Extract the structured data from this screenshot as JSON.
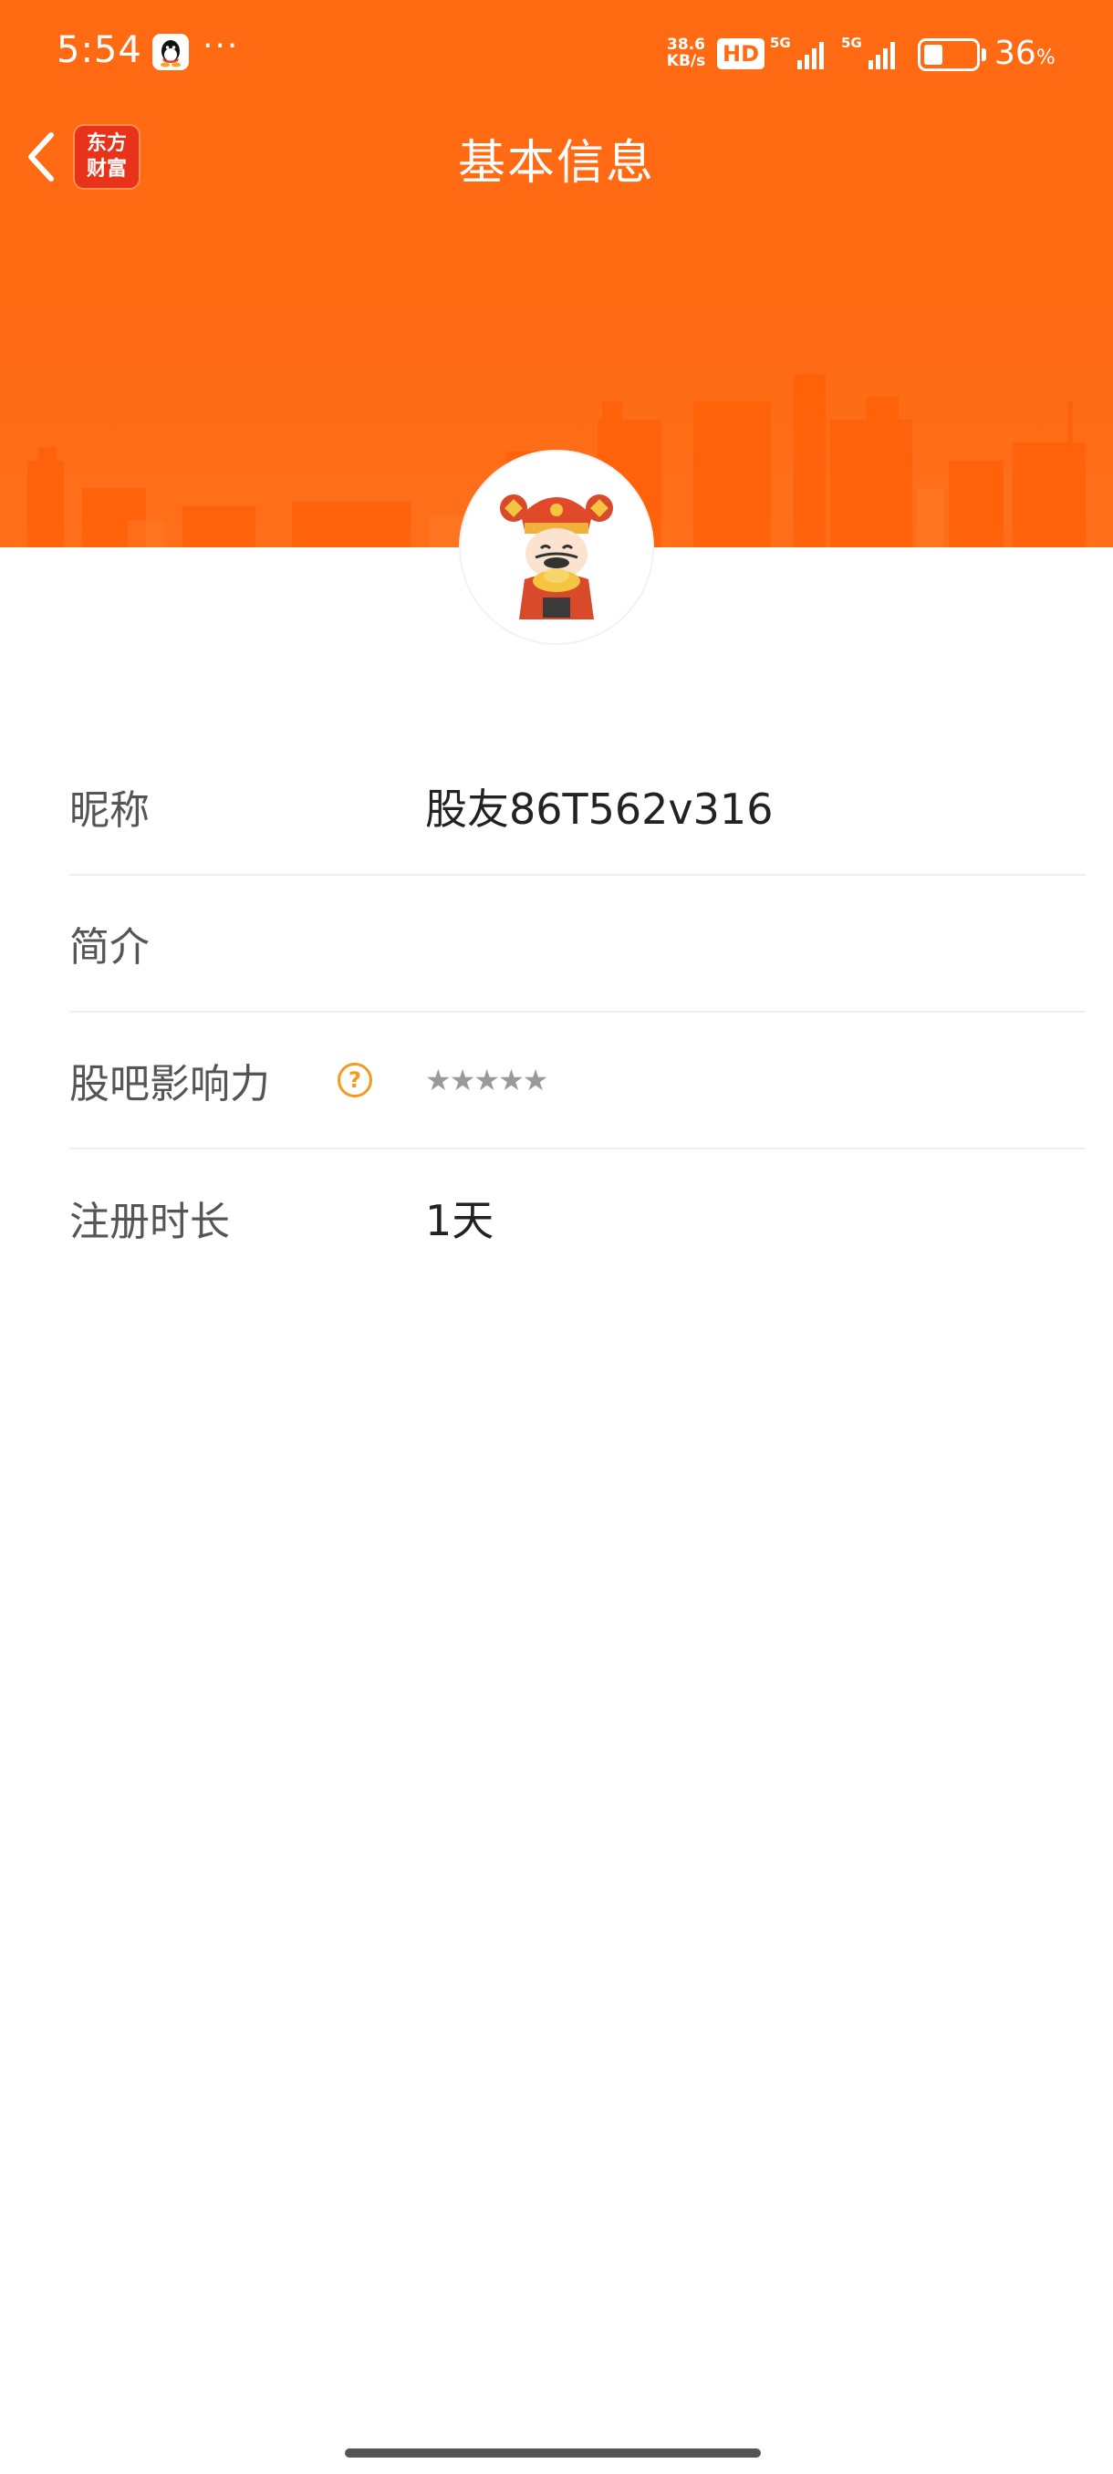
{
  "status_bar": {
    "time": "5:54",
    "dots": "···",
    "net_speed_value": "38.6",
    "net_speed_unit": "KB/s",
    "hd_label": "HD",
    "network_1": "5G",
    "network_2": "5G",
    "battery_level": 0.36,
    "battery_value": "36",
    "battery_unit": "%"
  },
  "nav": {
    "logo_line1": "东方",
    "logo_line2": "财富",
    "title": "基本信息"
  },
  "colors": {
    "brand_orange": "#ff6a13",
    "help_orange": "#f39a1f",
    "star_gray": "#9a9a9a"
  },
  "profile": {
    "nickname_label": "昵称",
    "nickname_value": "股友86T562v316",
    "bio_label": "简介",
    "bio_value": "",
    "influence_label": "股吧影响力",
    "influence_help": "?",
    "influence_stars": "★★★★★",
    "influence_rating": 0,
    "register_label": "注册时长",
    "register_value": "1天"
  }
}
